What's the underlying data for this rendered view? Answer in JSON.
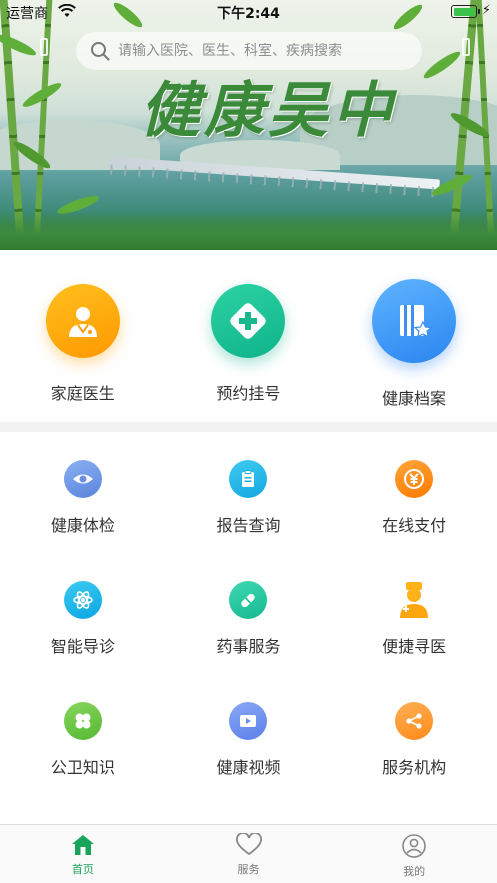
{
  "status_bar": {
    "carrier": "运营商",
    "time": "下午2:44"
  },
  "banner": {
    "title": "健康吴中",
    "sign_text": ""
  },
  "search": {
    "placeholder": "请输入医院、医生、科室、疾病搜索",
    "icon": "search-icon"
  },
  "main_services": [
    {
      "label": "家庭医生",
      "icon": "doctor-icon",
      "color": "#ffa50a"
    },
    {
      "label": "预约挂号",
      "icon": "medical-cross-icon",
      "color": "#1ec497"
    },
    {
      "label": "健康档案",
      "icon": "record-book-icon",
      "color": "#3a95f5"
    }
  ],
  "services": [
    {
      "label": "健康体检",
      "icon": "eye-icon",
      "color": "#6b95e6"
    },
    {
      "label": "报告查询",
      "icon": "report-icon",
      "color": "#1fb8e8"
    },
    {
      "label": "在线支付",
      "icon": "yuan-icon",
      "color": "#ff8a10"
    },
    {
      "label": "智能导诊",
      "icon": "atom-icon",
      "color": "#16b6ea"
    },
    {
      "label": "药事服务",
      "icon": "pill-icon",
      "color": "#2cc9a3"
    },
    {
      "label": "便捷寻医",
      "icon": "nurse-icon",
      "color": "#ffad15"
    },
    {
      "label": "公卫知识",
      "icon": "clover-icon",
      "color": "#6cc845"
    },
    {
      "label": "健康视频",
      "icon": "video-icon",
      "color": "#6d91f0"
    },
    {
      "label": "服务机构",
      "icon": "share-icon",
      "color": "#ff9830"
    }
  ],
  "tabs": [
    {
      "label": "首页",
      "icon": "home-icon",
      "active": true
    },
    {
      "label": "服务",
      "icon": "heart-icon",
      "active": false
    },
    {
      "label": "我的",
      "icon": "user-icon",
      "active": false
    }
  ],
  "colors": {
    "accent": "#1aa35a",
    "tab_inactive": "#777777"
  }
}
